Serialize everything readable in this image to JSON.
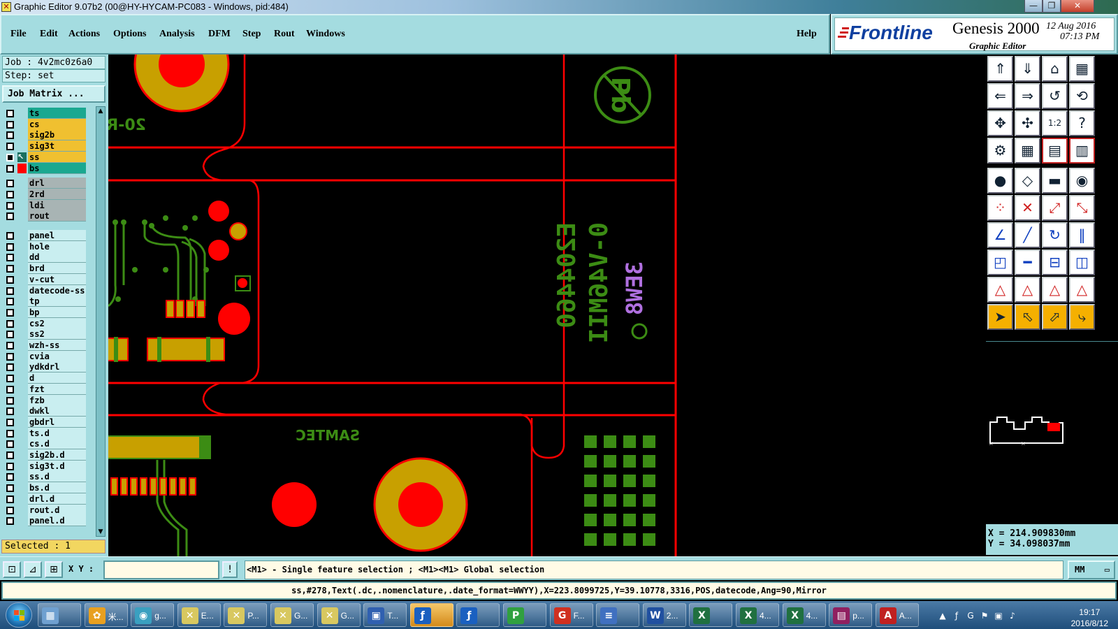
{
  "window": {
    "title": "Graphic Editor 9.07b2 (00@HY-HYCAM-PC083 - Windows, pid:484)",
    "controls": [
      "minimize-icon",
      "restore-icon",
      "close-icon"
    ]
  },
  "menu": [
    "File",
    "Edit",
    "Actions",
    "Options",
    "Analysis",
    "DFM",
    "Step",
    "Rout",
    "Windows"
  ],
  "help_label": "Help",
  "brand": {
    "logo": "Frontline",
    "product": "Genesis 2000",
    "subtitle": "Graphic Editor",
    "date": "12 Aug 2016",
    "time": "07:13 PM"
  },
  "job": {
    "label": "Job : 4v2mc0z6a0",
    "step": "Step: set",
    "matrix_button": "Job Matrix ..."
  },
  "layers": [
    {
      "name": "ts",
      "color": "#1aa890"
    },
    {
      "name": "cs",
      "color": "#f0c030"
    },
    {
      "name": "sig2b",
      "color": "#f0c030"
    },
    {
      "name": "sig3t",
      "color": "#f0c030"
    },
    {
      "name": "ss",
      "color": "#f0c030",
      "active": true
    },
    {
      "name": "bs",
      "color": "#1aa890"
    },
    {
      "name": "drl",
      "color": "#a8b4b4"
    },
    {
      "name": "2rd",
      "color": "#a8b4b4"
    },
    {
      "name": "ldi",
      "color": "#a8b4b4"
    },
    {
      "name": "rout",
      "color": "#a8b4b4"
    },
    {
      "name": "panel",
      "color": "#c9eef0"
    },
    {
      "name": "hole",
      "color": "#c9eef0"
    },
    {
      "name": "dd",
      "color": "#c9eef0"
    },
    {
      "name": "brd",
      "color": "#c9eef0"
    },
    {
      "name": "v-cut",
      "color": "#c9eef0"
    },
    {
      "name": "datecode-ss",
      "color": "#c9eef0"
    },
    {
      "name": "tp",
      "color": "#c9eef0"
    },
    {
      "name": "bp",
      "color": "#c9eef0"
    },
    {
      "name": "cs2",
      "color": "#c9eef0"
    },
    {
      "name": "ss2",
      "color": "#c9eef0"
    },
    {
      "name": "wzh-ss",
      "color": "#c9eef0"
    },
    {
      "name": "cvia",
      "color": "#c9eef0"
    },
    {
      "name": "ydkdrl",
      "color": "#c9eef0"
    },
    {
      "name": "d",
      "color": "#c9eef0"
    },
    {
      "name": "fzt",
      "color": "#c9eef0"
    },
    {
      "name": "fzb",
      "color": "#c9eef0"
    },
    {
      "name": "dwkl",
      "color": "#c9eef0"
    },
    {
      "name": "gbdrl",
      "color": "#c9eef0"
    },
    {
      "name": "ts.d",
      "color": "#c9eef0"
    },
    {
      "name": "cs.d",
      "color": "#c9eef0"
    },
    {
      "name": "sig2b.d",
      "color": "#c9eef0"
    },
    {
      "name": "sig3t.d",
      "color": "#c9eef0"
    },
    {
      "name": "ss.d",
      "color": "#c9eef0"
    },
    {
      "name": "bs.d",
      "color": "#c9eef0"
    },
    {
      "name": "drl.d",
      "color": "#c9eef0"
    },
    {
      "name": "rout.d",
      "color": "#c9eef0"
    },
    {
      "name": "panel.d",
      "color": "#c9eef0"
    }
  ],
  "selected": "Selected : 1",
  "canvas_text": {
    "topleft_mirror": "20-R",
    "samtec": "SAMTEC",
    "code1": "E204460",
    "code2": "0-V46MII",
    "code3": "3EW8"
  },
  "colors": {
    "red": "#ff0000",
    "green": "#3c8c14",
    "gold": "#c8a000",
    "purple": "#b070e0"
  },
  "toolbar_icons": [
    "zoom-home-icon",
    "zoom-down-icon",
    "home-icon",
    "window-icon",
    "pan-left-icon",
    "pan-right-icon",
    "pan-back-icon",
    "redraw-icon",
    "fit-icon",
    "zoom-fit-icon",
    "one-to-one-icon",
    "help-icon",
    "tools-icon",
    "grid-icon",
    "layers-a-icon",
    "layers-b-icon",
    "add-pad-icon",
    "add-line-icon",
    "measure-icon",
    "select-pad-icon",
    "connect-icon",
    "delete-icon",
    "move-icon",
    "copy-icon",
    "line-icon",
    "slash-icon",
    "arc-icon",
    "flip-icon",
    "snap-icon",
    "cut-icon",
    "size-icon",
    "fill-icon",
    "warning-a-icon",
    "warning-b-icon",
    "warning-c-icon",
    "warning-d-icon",
    "pointer-icon",
    "select-box-icon",
    "select-poly-icon",
    "route-icon"
  ],
  "coords": {
    "x": "X = 214.909830mm",
    "y": "Y = 34.098037mm"
  },
  "bottom": {
    "xy_label": "X Y :",
    "hint": "<M1> - Single feature selection ; <M1><M1> Global selection",
    "unit": "MM",
    "status": "ss,#278,Text(.dc,.nomenclature,.date_format=WWYY),X=223.8099725,Y=39.10778,3316,POS,datecode,Ang=90,Mirror"
  },
  "taskbar": {
    "items": [
      {
        "label": "",
        "icon": "calculator-icon",
        "color": "#6fa0d0"
      },
      {
        "label": "米...",
        "icon": "flower-icon",
        "color": "#e8a020"
      },
      {
        "label": "g...",
        "icon": "eye-icon",
        "color": "#3aa0c0"
      },
      {
        "label": "E...",
        "icon": "x-window-icon",
        "color": "#d8c860"
      },
      {
        "label": "P...",
        "icon": "x-window-icon",
        "color": "#d8c860"
      },
      {
        "label": "G...",
        "icon": "x-window-icon",
        "color": "#d8c860"
      },
      {
        "label": "G...",
        "icon": "x-window-icon",
        "color": "#d8c860"
      },
      {
        "label": "T...",
        "icon": "floppy-icon",
        "color": "#3060b0"
      },
      {
        "label": "",
        "icon": "frontline-icon",
        "color": "#1a60c0",
        "active": true
      },
      {
        "label": "",
        "icon": "frontline-icon",
        "color": "#1a60c0"
      },
      {
        "label": "",
        "icon": "p-icon",
        "color": "#30a040"
      },
      {
        "label": "F...",
        "icon": "g-icon",
        "color": "#d03020"
      },
      {
        "label": "",
        "icon": "notepad-icon",
        "color": "#4070c0"
      },
      {
        "label": "2...",
        "icon": "word-icon",
        "color": "#2050a0"
      },
      {
        "label": "",
        "icon": "excel-icon",
        "color": "#207040"
      },
      {
        "label": "4...",
        "icon": "excel-icon",
        "color": "#207040"
      },
      {
        "label": "4...",
        "icon": "excel-icon",
        "color": "#207040"
      },
      {
        "label": "p...",
        "icon": "winrar-icon",
        "color": "#902060"
      },
      {
        "label": "A...",
        "icon": "acrobat-icon",
        "color": "#c02020"
      }
    ],
    "time": "19:17",
    "date": "2016/8/12"
  }
}
